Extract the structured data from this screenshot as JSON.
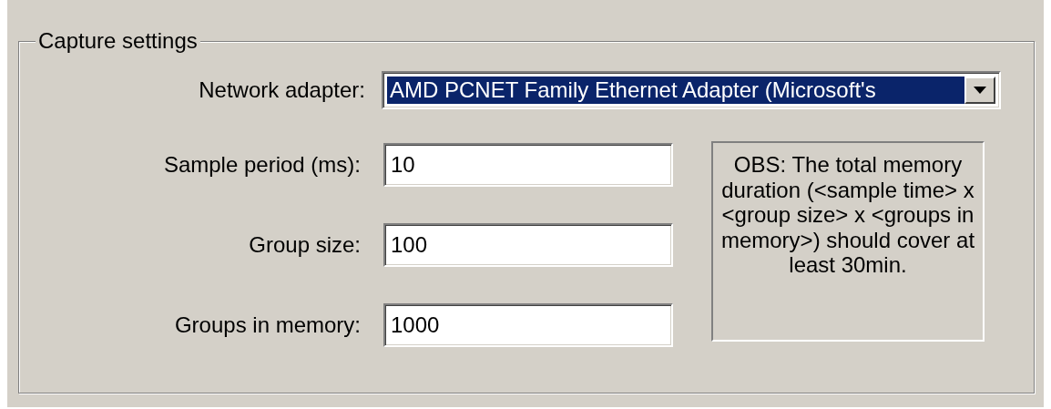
{
  "group": {
    "title": "Capture settings"
  },
  "adapter": {
    "label": "Network adapter:",
    "value": "AMD PCNET Family Ethernet Adapter (Microsoft's",
    "selected": true
  },
  "fields": [
    {
      "label": "Sample period (ms):",
      "value": "10"
    },
    {
      "label": "Group size:",
      "value": "100"
    },
    {
      "label": "Groups in memory:",
      "value": "1000"
    }
  ],
  "note": "OBS: The total memory duration (<sample time> x <group size> x <groups in memory>) should cover at least 30min."
}
